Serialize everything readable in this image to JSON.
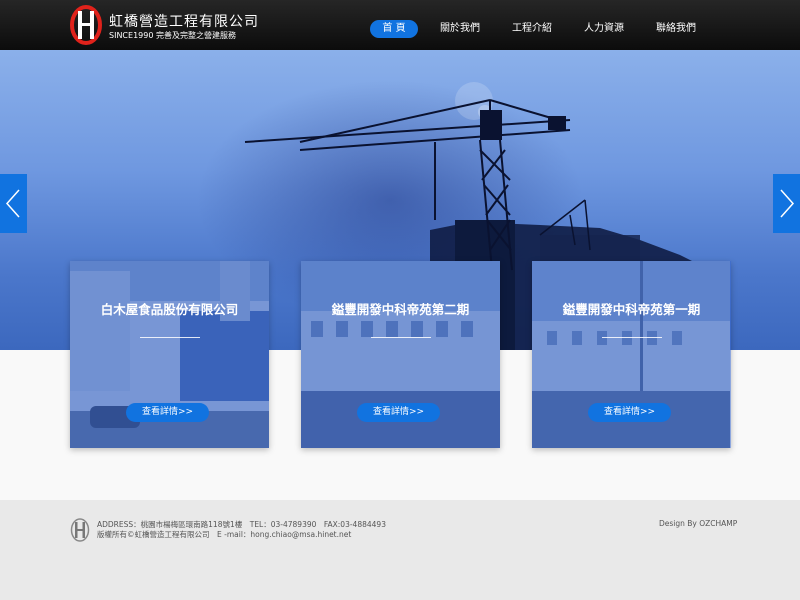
{
  "header": {
    "brand_name": "虹橋營造工程有限公司",
    "slogan": "SINCE1990 完善及完整之營建服務",
    "nav": [
      {
        "label": "首 頁",
        "active": true
      },
      {
        "label": "關於我們",
        "active": false
      },
      {
        "label": "工程介紹",
        "active": false
      },
      {
        "label": "人力資源",
        "active": false
      },
      {
        "label": "聯絡我們",
        "active": false
      }
    ]
  },
  "hero": {
    "prev_icon": "chevron-left-icon",
    "next_icon": "chevron-right-icon"
  },
  "cards": [
    {
      "title": "白木屋食品股份有限公司",
      "button": "查看詳情>>"
    },
    {
      "title": "鎰豐開發中科帝苑第二期",
      "button": "查看詳情>>"
    },
    {
      "title": "鎰豐開發中科帝苑第一期",
      "button": "查看詳情>>"
    }
  ],
  "footer": {
    "line1": "ADDRESS：桃園市楊梅區環南路118號1樓　TEL：03-4789390　FAX:03-4884493",
    "line2": "版權所有©虹橋營造工程有限公司　E -mail：hong.chiao@msa.hinet.net",
    "design_by": "Design By OZCHAMP"
  },
  "colors": {
    "accent": "#1173e0",
    "header_bg": "#111111",
    "footer_bg": "#e9e9e9",
    "logo_red": "#e0221b"
  }
}
